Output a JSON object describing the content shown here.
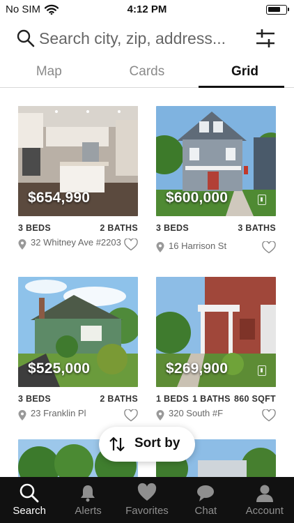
{
  "status_bar": {
    "carrier": "No SIM",
    "time": "4:12 PM"
  },
  "search": {
    "placeholder": "Search city, zip, address..."
  },
  "tabs": [
    {
      "label": "Map",
      "active": false
    },
    {
      "label": "Cards",
      "active": false
    },
    {
      "label": "Grid",
      "active": true
    }
  ],
  "listings": [
    {
      "price": "$654,990",
      "beds": "3 BEDS",
      "baths": "2 BATHS",
      "address": "32 Whitney Ave #2203",
      "scene": "kitchen"
    },
    {
      "price": "$600,000",
      "beds": "3 BEDS",
      "baths": "3 BATHS",
      "address": "16 Harrison St",
      "scene": "grey-house",
      "virtual_tour": true
    },
    {
      "price": "$525,000",
      "beds": "3 BEDS",
      "baths": "2 BATHS",
      "address": "23 Franklin Pl",
      "scene": "green-house"
    },
    {
      "price": "$269,900",
      "beds": "1 BEDS",
      "baths": "1 BATHS",
      "sqft": "860 SQFT",
      "address": "320 South #F",
      "scene": "brick-house",
      "virtual_tour": true
    },
    {
      "scene": "trees"
    },
    {
      "scene": "trees-sky"
    }
  ],
  "sort": {
    "label": "Sort by"
  },
  "bottom_nav": [
    {
      "label": "Search",
      "icon": "search-icon",
      "active": true
    },
    {
      "label": "Alerts",
      "icon": "bell-icon",
      "active": false
    },
    {
      "label": "Favorites",
      "icon": "heart-icon",
      "active": false
    },
    {
      "label": "Chat",
      "icon": "chat-bubble-icon",
      "active": false
    },
    {
      "label": "Account",
      "icon": "person-icon",
      "active": false
    }
  ]
}
